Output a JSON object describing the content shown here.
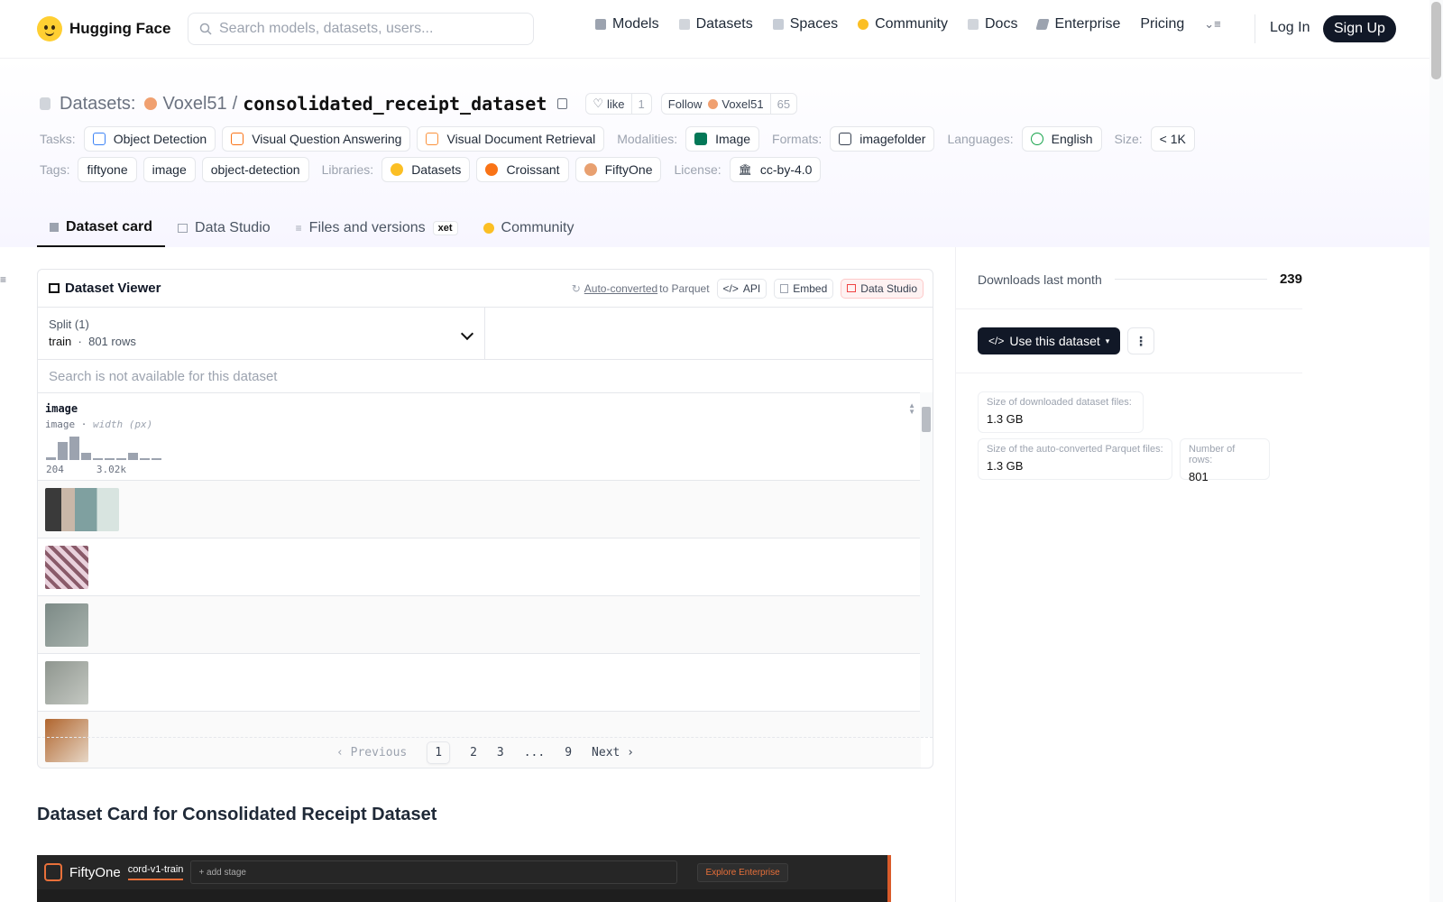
{
  "nav": {
    "brand": "Hugging Face",
    "search_placeholder": "Search models, datasets, users...",
    "links": [
      {
        "label": "Models",
        "icon": "cube-icon",
        "color": "#9ca3af"
      },
      {
        "label": "Datasets",
        "icon": "database-icon",
        "color": "#d1d5db"
      },
      {
        "label": "Spaces",
        "icon": "grid-icon",
        "color": "#c7cdd6"
      },
      {
        "label": "Community",
        "icon": "hugging-hands-icon",
        "color": "#fbbf24"
      },
      {
        "label": "Docs",
        "icon": "book-icon",
        "color": "#d1d5db"
      },
      {
        "label": "Enterprise",
        "icon": "enterprise-icon",
        "color": "#9ca3af"
      },
      {
        "label": "Pricing",
        "icon": "",
        "color": ""
      }
    ],
    "login": "Log In",
    "signup": "Sign Up"
  },
  "header": {
    "section": "Datasets:",
    "owner": "Voxel51",
    "slash": "/",
    "name": "consolidated_receipt_dataset",
    "like_label": "like",
    "like_count": "1",
    "follow_label": "Follow",
    "follow_name": "Voxel51",
    "follow_count": "65"
  },
  "meta": {
    "tasks_label": "Tasks:",
    "tasks": [
      "Object Detection",
      "Visual Question Answering",
      "Visual Document Retrieval"
    ],
    "modalities_label": "Modalities:",
    "modality": "Image",
    "formats_label": "Formats:",
    "format": "imagefolder",
    "languages_label": "Languages:",
    "language": "English",
    "size_label": "Size:",
    "size": "< 1K",
    "tags_label": "Tags:",
    "tags": [
      "fiftyone",
      "image",
      "object-detection"
    ],
    "libraries_label": "Libraries:",
    "libraries": [
      "Datasets",
      "Croissant",
      "FiftyOne"
    ],
    "license_label": "License:",
    "license": "cc-by-4.0"
  },
  "tabs": [
    {
      "label": "Dataset card",
      "active": true
    },
    {
      "label": "Data Studio",
      "active": false
    },
    {
      "label": "Files and versions",
      "active": false,
      "badge": "xet"
    },
    {
      "label": "Community",
      "active": false
    }
  ],
  "viewer": {
    "title": "Dataset Viewer",
    "auto_converted": "Auto-converted",
    "to_parquet": "to Parquet",
    "api": "API",
    "embed": "Embed",
    "data_studio": "Data Studio",
    "split_label": "Split (1)",
    "split_name": "train",
    "split_rows": "801 rows",
    "search_na": "Search is not available for this dataset",
    "column_name": "image",
    "column_type": "image",
    "column_unit": "width (px)",
    "hist_min": "204",
    "hist_max": "3.02k",
    "hist_values": [
      0.1,
      0.75,
      1.0,
      0.3,
      0.05,
      0.05,
      0.0,
      0.3,
      0.0,
      0.05
    ],
    "pager": {
      "prev": "Previous",
      "pages": [
        "1",
        "2",
        "3",
        "...",
        "9"
      ],
      "next": "Next",
      "current": "1"
    }
  },
  "card": {
    "title": "Dataset Card for Consolidated Receipt Dataset",
    "fo_brand": "FiftyOne",
    "fo_dataset": "cord-v1-train",
    "fo_stage": "+ add stage",
    "fo_enterprise": "Explore Enterprise"
  },
  "sidebar": {
    "downloads_label": "Downloads last month",
    "downloads": "239",
    "use_button": "Use this dataset",
    "size_download_label": "Size of downloaded dataset files:",
    "size_download": "1.3 GB",
    "size_parquet_label": "Size of the auto-converted Parquet files:",
    "size_parquet": "1.3 GB",
    "rows_label": "Number of rows:",
    "rows": "801"
  }
}
